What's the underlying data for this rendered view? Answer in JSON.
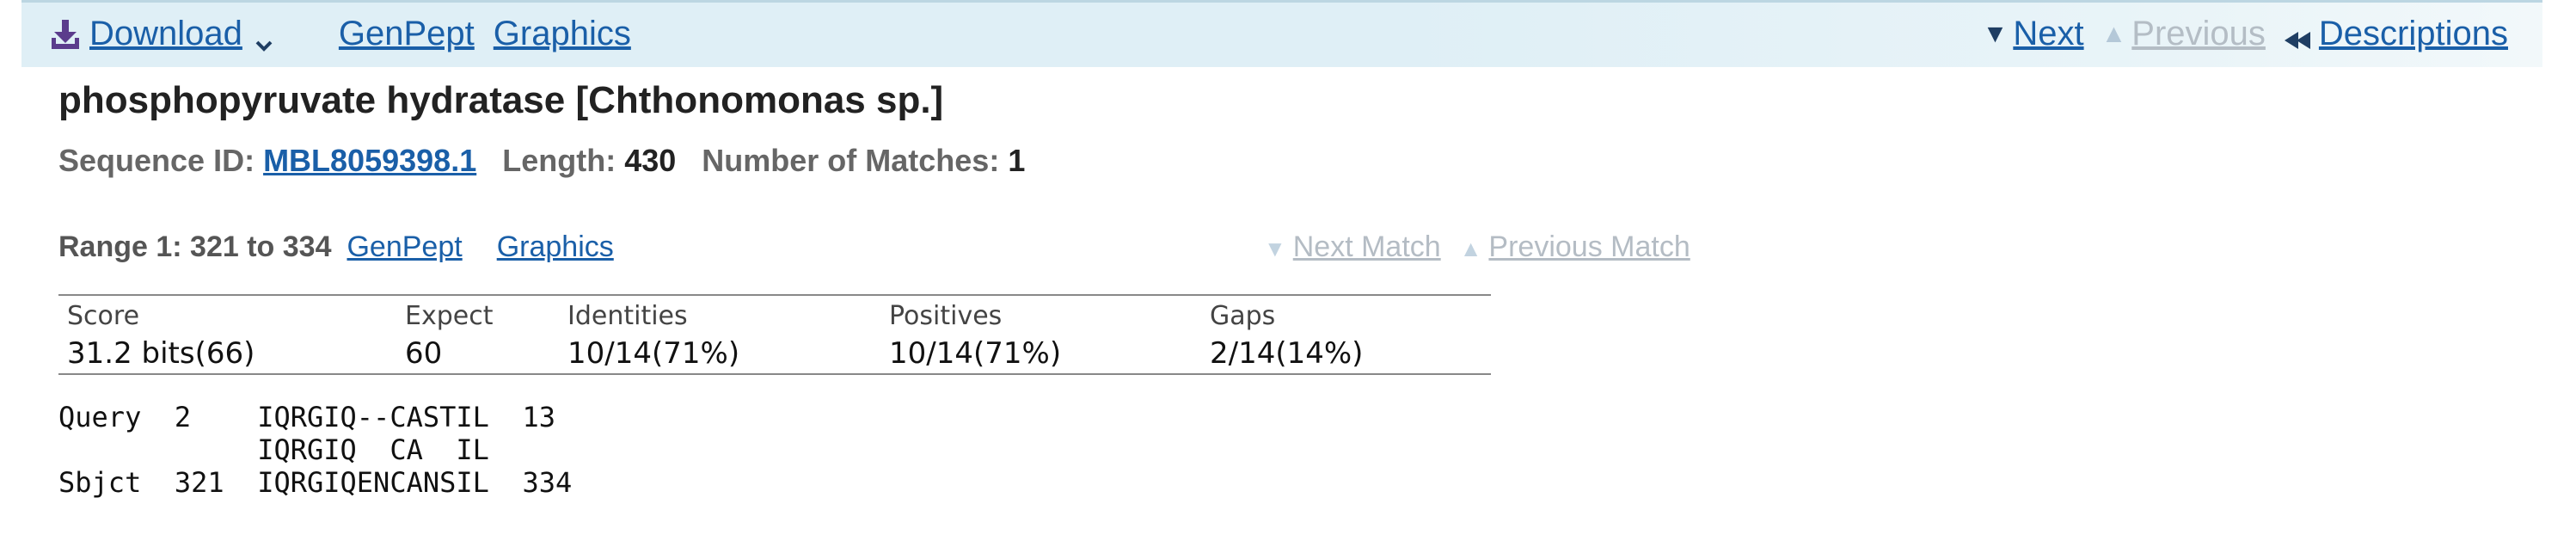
{
  "toolbar": {
    "download_label": "Download",
    "links": [
      "GenPept",
      "Graphics"
    ],
    "next_label": "Next",
    "previous_label": "Previous",
    "descriptions_label": "Descriptions",
    "next_icon": "triangle-down-icon",
    "previous_icon": "triangle-up-icon",
    "descriptions_icon": "double-arrow-left-icon"
  },
  "hit": {
    "title": "phosphopyruvate hydratase [Chthonomonas sp.]",
    "sequence_id_label": "Sequence ID:",
    "sequence_id": "MBL8059398.1",
    "length_label": "Length:",
    "length": "430",
    "matches_label": "Number of Matches:",
    "matches": "1"
  },
  "range": {
    "label": "Range 1: 321 to 334",
    "genpept_label": "GenPept",
    "graphics_label": "Graphics",
    "next_match_label": "Next Match",
    "previous_match_label": "Previous Match"
  },
  "stats": {
    "headers": [
      "Score",
      "Expect",
      "Identities",
      "Positives",
      "Gaps"
    ],
    "values": [
      "31.2 bits(66)",
      "60",
      "10/14(71%)",
      "10/14(71%)",
      "2/14(14%)"
    ]
  },
  "alignment": {
    "query_line": "Query  2    IQRGIQ--CASTIL  13",
    "match_line": "            IQRGIQ  CA  IL",
    "sbjct_line": "Sbjct  321  IQRGIQENCANSIL  334"
  },
  "colors": {
    "link": "#1a5fa8",
    "toolbar_bg": "#dfeff6",
    "disabled": "#b4bdc5",
    "download_icon": "#5b3c8c"
  }
}
